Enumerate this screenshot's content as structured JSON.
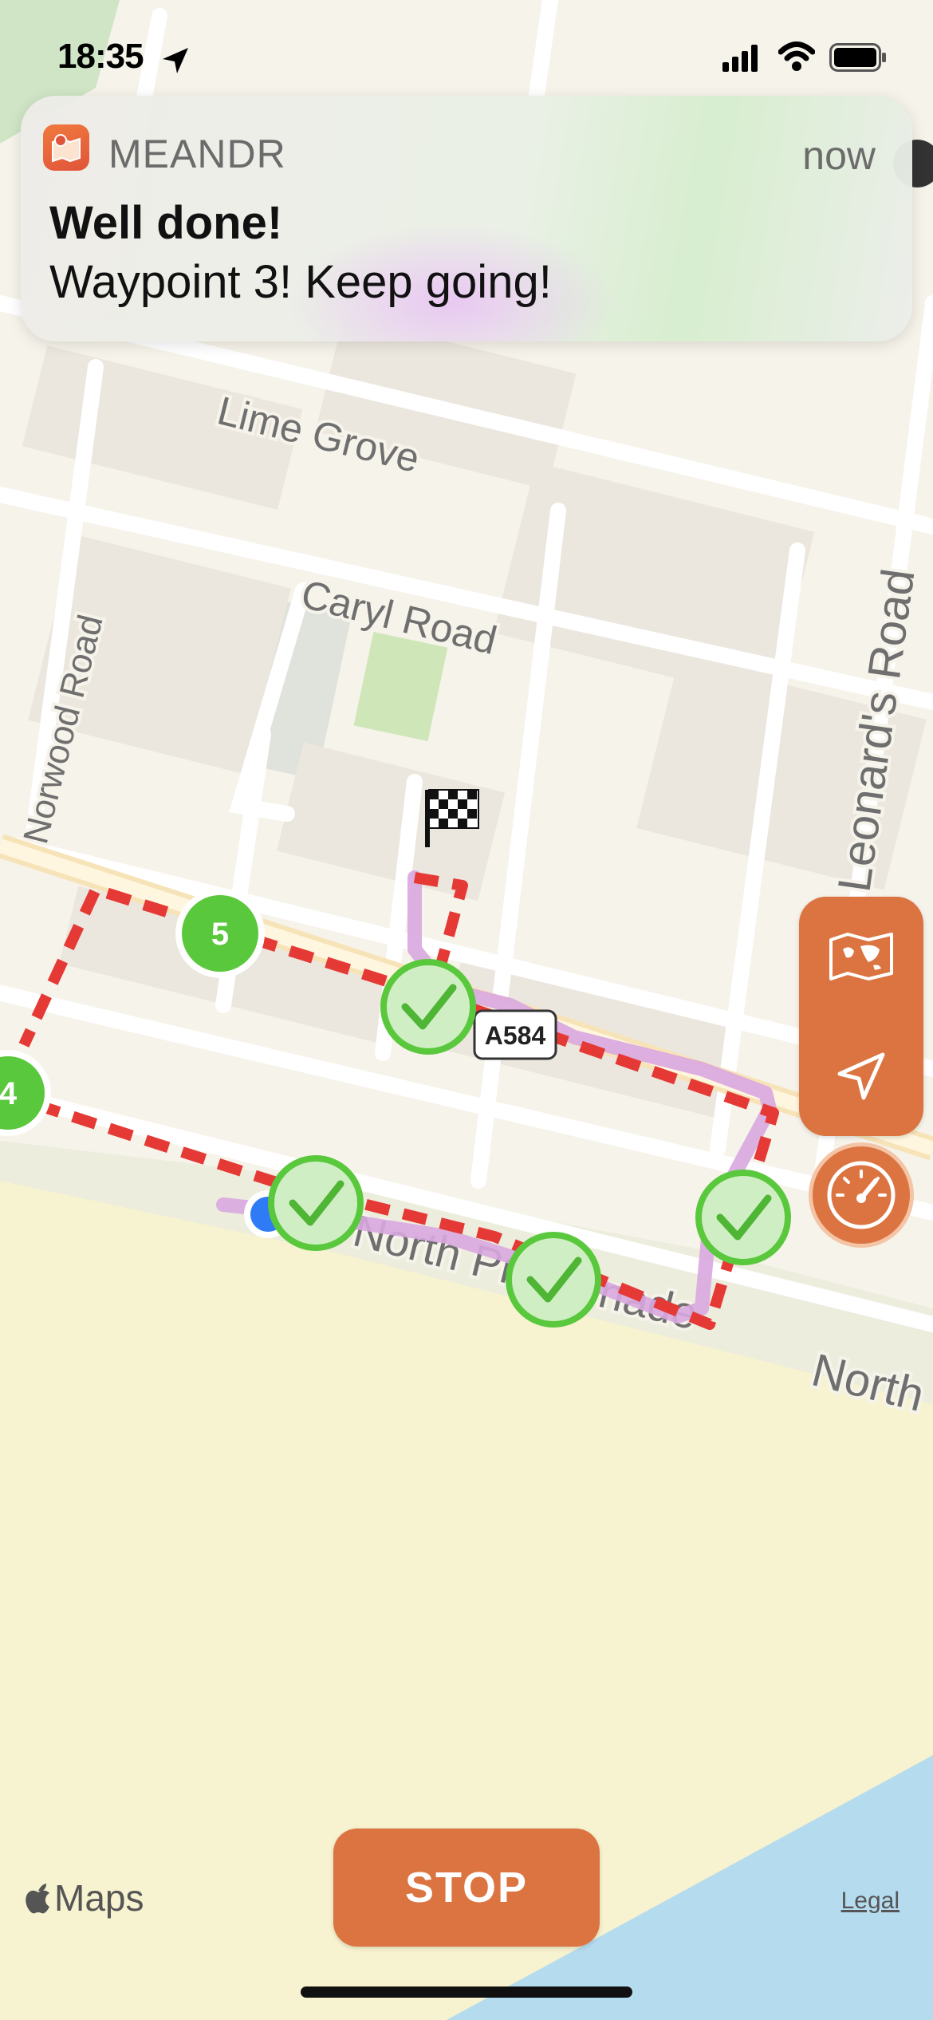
{
  "status_bar": {
    "time": "18:35"
  },
  "notification": {
    "app_name": "MEANDR",
    "time": "now",
    "title": "Well done!",
    "body": "Waypoint 3! Keep going!"
  },
  "map": {
    "street_labels": {
      "lime_grove": "Lime Grove",
      "caryl_road": "Caryl Road",
      "norwood_road": "Norwood Road",
      "leonards_road": "Leonard's Road",
      "north_promenade": "North Promenade",
      "north": "North",
      "road_sign": "A584"
    },
    "waypoints": [
      {
        "label": "4",
        "completed": false
      },
      {
        "label": "5",
        "completed": false
      },
      {
        "label": "✓",
        "completed": true
      },
      {
        "label": "✓",
        "completed": true
      },
      {
        "label": "✓",
        "completed": true
      },
      {
        "label": "✓",
        "completed": true
      }
    ],
    "route_color": "#e53935",
    "track_color": "#d9a7e0",
    "waypoint_color": "#5ac83c"
  },
  "controls": {
    "map_button_icon": "map-icon",
    "locate_button_icon": "location-arrow-icon",
    "speed_button_icon": "speedometer-icon",
    "stop_label": "STOP",
    "accent": "#db7441"
  },
  "footer": {
    "maps_label": "Maps",
    "legal_label": "Legal"
  }
}
